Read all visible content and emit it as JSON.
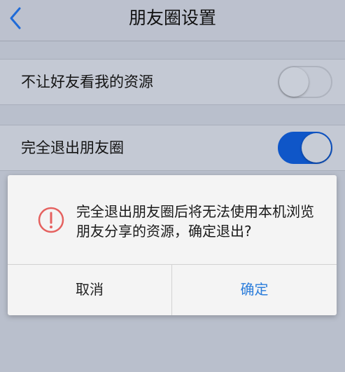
{
  "navbar": {
    "title": "朋友圈设置",
    "back_icon": "chevron-left-icon"
  },
  "settings": [
    {
      "label": "不让好友看我的资源",
      "toggle_on": false
    },
    {
      "label": "完全退出朋友圈",
      "toggle_on": true
    }
  ],
  "dialog": {
    "icon": "alert-circle-icon",
    "message": "完全退出朋友圈后将无法使用本机浏览朋友分享的资源，确定退出?",
    "cancel_label": "取消",
    "confirm_label": "确定"
  },
  "colors": {
    "accent": "#1f6bd8",
    "toggle_on": "#0f56c8",
    "alert": "#e5615f",
    "confirm_text": "#2b7ddb"
  }
}
